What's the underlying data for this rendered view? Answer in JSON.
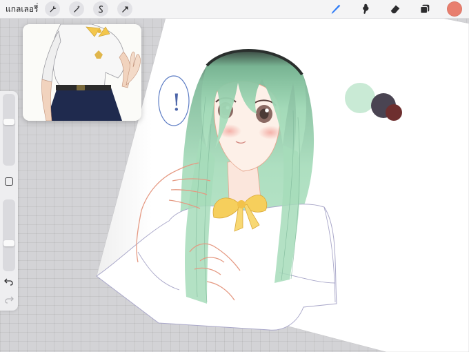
{
  "toolbar": {
    "gallery_label": "แกลเลอรี่",
    "left_tools": [
      {
        "name": "actions-wrench-icon"
      },
      {
        "name": "adjustments-wand-icon"
      },
      {
        "name": "selection-s-icon"
      },
      {
        "name": "transform-arrow-icon"
      }
    ],
    "right_tools": [
      {
        "name": "brush-icon",
        "active": true
      },
      {
        "name": "smudge-icon"
      },
      {
        "name": "eraser-icon"
      },
      {
        "name": "layers-icon"
      }
    ],
    "current_color": "#e87e6e"
  },
  "sidebar": {
    "brush_size_level": 0.62,
    "opacity_level": 0.38,
    "modify_icon": "square-icon",
    "undo_icon": "undo-arrow-icon",
    "redo_icon": "redo-arrow-icon"
  },
  "reference_window": {
    "content": "school-uniform-reference"
  },
  "canvas": {
    "speech_bubble_text": "!",
    "palette_swatches": [
      "#c9ead5",
      "#4a4452",
      "#6e2f2f"
    ]
  },
  "colors": {
    "toolbar_bg": "#f4f4f5",
    "workspace_bg": "#d3d3d6",
    "accent_blue": "#2f7cf6",
    "hair_green": "#9bd4b0",
    "bow_yellow": "#f6cf5c"
  }
}
